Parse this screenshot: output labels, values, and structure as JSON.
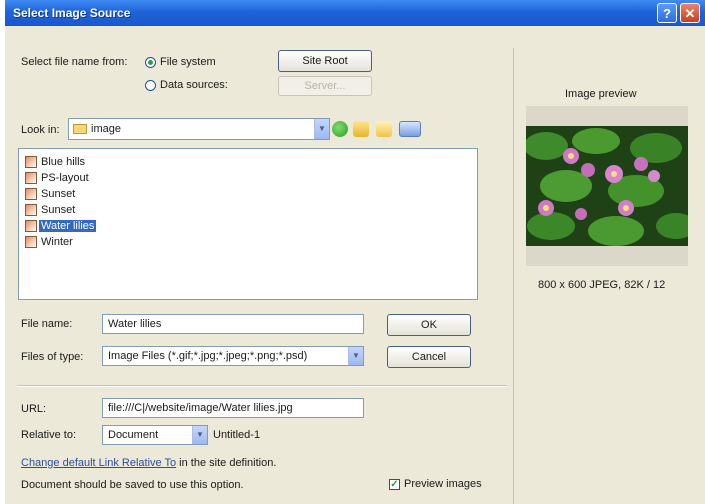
{
  "window": {
    "title": "Select Image Source"
  },
  "select_from": {
    "label": "Select file name from:",
    "options": [
      {
        "label": "File system",
        "selected": true
      },
      {
        "label": "Data sources:",
        "selected": false
      }
    ],
    "site_root_button": "Site Root",
    "server_button": "Server..."
  },
  "look_in": {
    "label": "Look in:",
    "value": "image"
  },
  "toolbar_icons": [
    "back-icon",
    "up-folder-icon",
    "new-folder-icon",
    "views-menu-icon"
  ],
  "files": [
    {
      "name": "Blue hills",
      "selected": false
    },
    {
      "name": "PS-layout",
      "selected": false
    },
    {
      "name": "Sunset",
      "selected": false
    },
    {
      "name": "Sunset",
      "selected": false
    },
    {
      "name": "Water lilies",
      "selected": true
    },
    {
      "name": "Winter",
      "selected": false
    }
  ],
  "file_name": {
    "label": "File name:",
    "value": "Water lilies"
  },
  "files_of_type": {
    "label": "Files of type:",
    "value": "Image Files (*.gif;*.jpg;*.jpeg;*.png;*.psd)"
  },
  "buttons": {
    "ok": "OK",
    "cancel": "Cancel"
  },
  "url": {
    "label": "URL:",
    "value": "file:///C|/website/image/Water lilies.jpg"
  },
  "relative_to": {
    "label": "Relative to:",
    "value": "Document",
    "doc_name": "Untitled-1"
  },
  "footer": {
    "link_text": "Change default Link Relative To",
    "link_suffix": " in the site definition.",
    "note": "Document should be saved to use this option.",
    "preview_checkbox_label": "Preview images",
    "preview_checked": true
  },
  "preview": {
    "title": "Image preview",
    "info": "800 x 600 JPEG, 82K / 12"
  },
  "colors": {
    "titlebar": "#1e63d8",
    "selection": "#316ac5",
    "dialog_bg": "#ece9d8"
  }
}
